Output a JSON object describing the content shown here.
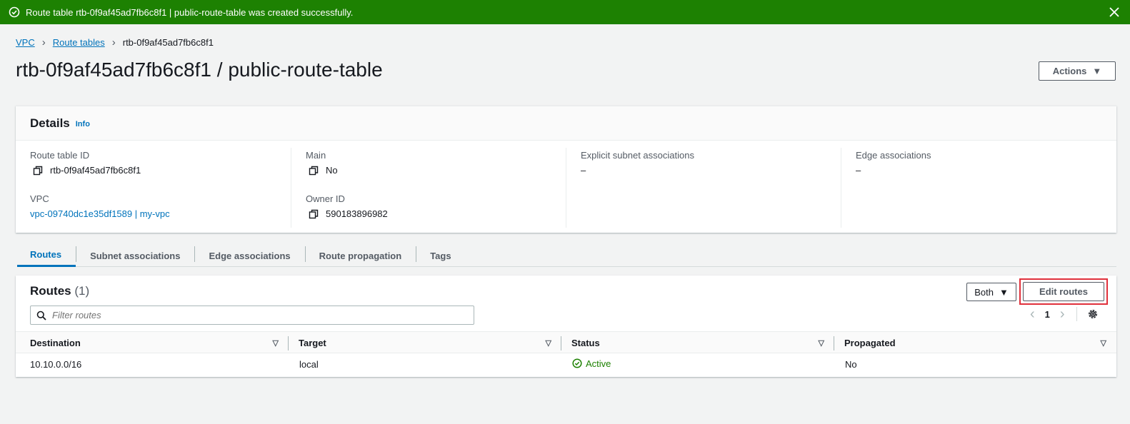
{
  "flash": {
    "message": "Route table rtb-0f9af45ad7fb6c8f1 | public-route-table was created successfully.",
    "icon": "success-check-icon",
    "color": "#1d8102"
  },
  "breadcrumb": {
    "items": [
      "VPC",
      "Route tables",
      "rtb-0f9af45ad7fb6c8f1"
    ]
  },
  "page": {
    "title": "rtb-0f9af45ad7fb6c8f1 / public-route-table",
    "actions_label": "Actions"
  },
  "details": {
    "title": "Details",
    "info_label": "Info",
    "route_table_id_label": "Route table ID",
    "route_table_id": "rtb-0f9af45ad7fb6c8f1",
    "main_label": "Main",
    "main_value": "No",
    "explicit_label": "Explicit subnet associations",
    "explicit_value": "–",
    "edge_label": "Edge associations",
    "edge_value": "–",
    "vpc_label": "VPC",
    "vpc_value": "vpc-09740dc1e35df1589 | my-vpc",
    "owner_label": "Owner ID",
    "owner_value": "590183896982"
  },
  "tabs": [
    "Routes",
    "Subnet associations",
    "Edge associations",
    "Route propagation",
    "Tags"
  ],
  "routes": {
    "title": "Routes",
    "count": "(1)",
    "filter_select": "Both",
    "edit_label": "Edit routes",
    "filter_placeholder": "Filter routes",
    "page_number": "1",
    "columns": [
      "Destination",
      "Target",
      "Status",
      "Propagated"
    ],
    "rows": [
      {
        "destination": "10.10.0.0/16",
        "target": "local",
        "status": "Active",
        "propagated": "No"
      }
    ],
    "status_color": "#1d8102"
  },
  "colors": {
    "link": "#0073bb",
    "highlight": "#e0303b"
  }
}
